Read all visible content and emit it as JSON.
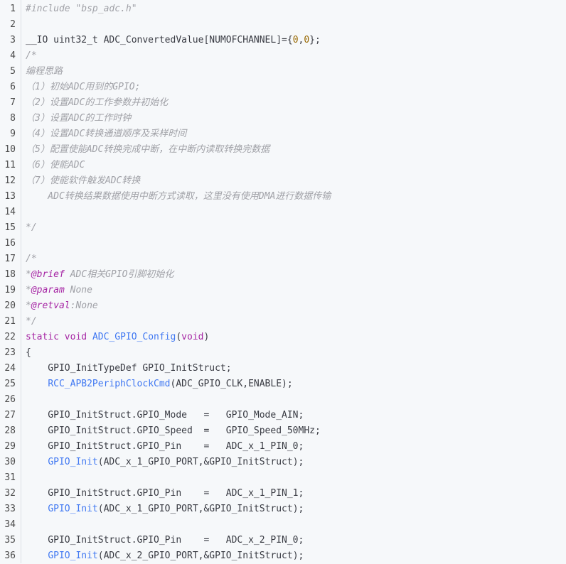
{
  "editor": {
    "language": "c",
    "colors": {
      "background": "#f6f8fa",
      "comment": "#a0a1a7",
      "keyword": "#a626a4",
      "function": "#4078f2",
      "number": "#986801",
      "text": "#383a42"
    },
    "line_numbers": [
      "1",
      "2",
      "3",
      "4",
      "5",
      "6",
      "7",
      "8",
      "9",
      "10",
      "11",
      "12",
      "13",
      "14",
      "15",
      "16",
      "17",
      "18",
      "19",
      "20",
      "21",
      "22",
      "23",
      "24",
      "25",
      "26",
      "27",
      "28",
      "29",
      "30",
      "31",
      "32",
      "33",
      "34",
      "35",
      "36"
    ],
    "lines": [
      [
        {
          "t": "#include \"bsp_adc.h\"",
          "c": "inc"
        }
      ],
      [],
      [
        {
          "t": "__IO uint32_t ADC_ConvertedValue[NUMOFCHANNEL]={",
          "c": ""
        },
        {
          "t": "0",
          "c": "num"
        },
        {
          "t": ",",
          "c": ""
        },
        {
          "t": "0",
          "c": "num"
        },
        {
          "t": "};",
          "c": ""
        }
      ],
      [
        {
          "t": "/*",
          "c": "comment"
        }
      ],
      [
        {
          "t": "编程思路",
          "c": "comment"
        }
      ],
      [
        {
          "t": "（1）初始ADC用到的GPIO;",
          "c": "comment"
        }
      ],
      [
        {
          "t": "（2）设置ADC的工作参数并初始化",
          "c": "comment"
        }
      ],
      [
        {
          "t": "（3）设置ADC的工作时钟",
          "c": "comment"
        }
      ],
      [
        {
          "t": "（4）设置ADC转换通道顺序及采样时间",
          "c": "comment"
        }
      ],
      [
        {
          "t": "（5）配置使能ADC转换完成中断，在中断内读取转换完数据",
          "c": "comment"
        }
      ],
      [
        {
          "t": "（6）使能ADC",
          "c": "comment"
        }
      ],
      [
        {
          "t": "（7）使能软件触发ADC转换",
          "c": "comment"
        }
      ],
      [
        {
          "t": "    ADC转换结果数据使用中断方式读取，这里没有使用DMA进行数据传输",
          "c": "comment"
        }
      ],
      [],
      [
        {
          "t": "*/",
          "c": "comment"
        }
      ],
      [],
      [
        {
          "t": "/*",
          "c": "comment"
        }
      ],
      [
        {
          "t": "*",
          "c": "comment"
        },
        {
          "t": "@brief",
          "c": "tag"
        },
        {
          "t": " ADC相关GPIO引脚初始化",
          "c": "comment"
        }
      ],
      [
        {
          "t": "*",
          "c": "comment"
        },
        {
          "t": "@param",
          "c": "tag"
        },
        {
          "t": " None",
          "c": "comment"
        }
      ],
      [
        {
          "t": "*",
          "c": "comment"
        },
        {
          "t": "@retval",
          "c": "tag"
        },
        {
          "t": ":None",
          "c": "comment"
        }
      ],
      [
        {
          "t": "*/",
          "c": "comment"
        }
      ],
      [
        {
          "t": "static",
          "c": "kw"
        },
        {
          "t": " ",
          "c": ""
        },
        {
          "t": "void",
          "c": "kw"
        },
        {
          "t": " ",
          "c": ""
        },
        {
          "t": "ADC_GPIO_Config",
          "c": "fn"
        },
        {
          "t": "(",
          "c": ""
        },
        {
          "t": "void",
          "c": "kw"
        },
        {
          "t": ")",
          "c": ""
        }
      ],
      [
        {
          "t": "{",
          "c": ""
        }
      ],
      [
        {
          "t": "    GPIO_InitTypeDef GPIO_InitStruct;",
          "c": ""
        }
      ],
      [
        {
          "t": "    ",
          "c": ""
        },
        {
          "t": "RCC_APB2PeriphClockCmd",
          "c": "fn"
        },
        {
          "t": "(ADC_GPIO_CLK,ENABLE);",
          "c": ""
        }
      ],
      [],
      [
        {
          "t": "    GPIO_InitStruct.GPIO_Mode   =   GPIO_Mode_AIN;",
          "c": ""
        }
      ],
      [
        {
          "t": "    GPIO_InitStruct.GPIO_Speed  =   GPIO_Speed_50MHz;",
          "c": ""
        }
      ],
      [
        {
          "t": "    GPIO_InitStruct.GPIO_Pin    =   ADC_x_1_PIN_0;",
          "c": ""
        }
      ],
      [
        {
          "t": "    ",
          "c": ""
        },
        {
          "t": "GPIO_Init",
          "c": "fn"
        },
        {
          "t": "(ADC_x_1_GPIO_PORT,&GPIO_InitStruct);",
          "c": ""
        }
      ],
      [],
      [
        {
          "t": "    GPIO_InitStruct.GPIO_Pin    =   ADC_x_1_PIN_1;",
          "c": ""
        }
      ],
      [
        {
          "t": "    ",
          "c": ""
        },
        {
          "t": "GPIO_Init",
          "c": "fn"
        },
        {
          "t": "(ADC_x_1_GPIO_PORT,&GPIO_InitStruct);",
          "c": ""
        }
      ],
      [],
      [
        {
          "t": "    GPIO_InitStruct.GPIO_Pin    =   ADC_x_2_PIN_0;",
          "c": ""
        }
      ],
      [
        {
          "t": "    ",
          "c": ""
        },
        {
          "t": "GPIO_Init",
          "c": "fn"
        },
        {
          "t": "(ADC_x_2_GPIO_PORT,&GPIO_InitStruct);",
          "c": ""
        }
      ]
    ]
  }
}
